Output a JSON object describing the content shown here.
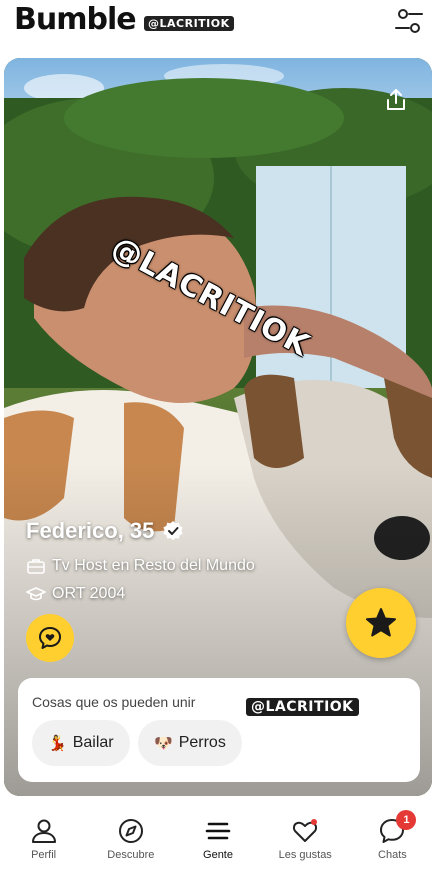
{
  "app": {
    "logo_text": "Bumble",
    "watermark_small": "@LACRITIOK"
  },
  "profile": {
    "name_age": "Federico, 35",
    "verified": true,
    "job": "Tv Host en Resto del Mundo",
    "education": "ORT 2004",
    "photo_watermark": "@LACRITIOK"
  },
  "common": {
    "title": "Cosas que os pueden unir",
    "watermark": "@LACRITIOK",
    "chips": [
      {
        "emoji": "💃",
        "label": "Bailar"
      },
      {
        "emoji": "🐶",
        "label": "Perros"
      }
    ]
  },
  "nav": {
    "items": [
      {
        "label": "Perfil",
        "icon": "person-icon"
      },
      {
        "label": "Descubre",
        "icon": "compass-icon"
      },
      {
        "label": "Gente",
        "icon": "stack-icon"
      },
      {
        "label": "Les gustas",
        "icon": "heart-icon"
      },
      {
        "label": "Chats",
        "icon": "chat-icon",
        "badge": "1"
      }
    ],
    "active": "Gente"
  },
  "colors": {
    "accent": "#ffcf2f",
    "badge": "#e53935"
  }
}
